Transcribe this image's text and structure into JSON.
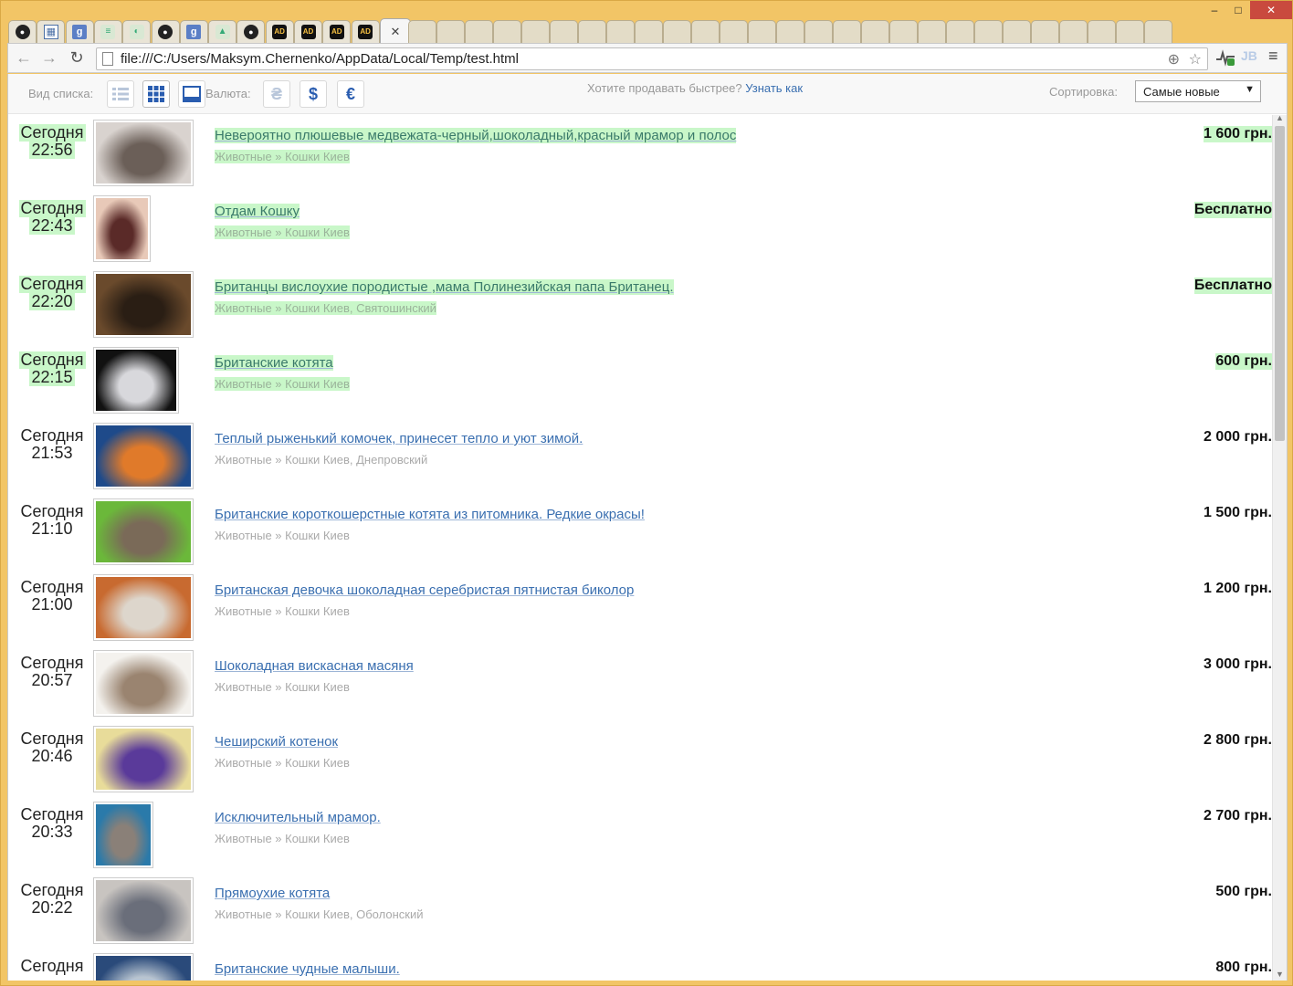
{
  "browser": {
    "url": "file:///C:/Users/Maksym.Chernenko/AppData/Local/Temp/test.html",
    "tabs": [
      {
        "icon": "github-icon"
      },
      {
        "icon": "grid-icon"
      },
      {
        "icon": "google-icon"
      },
      {
        "icon": "doc-icon"
      },
      {
        "icon": "code-icon"
      },
      {
        "icon": "github-icon"
      },
      {
        "icon": "google-icon"
      },
      {
        "icon": "ghost-icon"
      },
      {
        "icon": "github-icon"
      },
      {
        "icon": "ad-icon"
      },
      {
        "icon": "ad-icon"
      },
      {
        "icon": "ad-icon"
      },
      {
        "icon": "ad-icon"
      }
    ],
    "active_tab_close": "✕",
    "ad_label": "AD",
    "win_buttons": {
      "minimize": "–",
      "maximize": "□",
      "close": "✕"
    }
  },
  "filters": {
    "view_label": "Вид списка:",
    "currency_label": "Валюта:",
    "currency_uah": "₴",
    "currency_usd": "$",
    "currency_eur": "€",
    "promo_text": "Хотите продавать быстрее?",
    "promo_link": "Узнать как",
    "sort_label": "Сортировка:",
    "sort_value": "Самые новые"
  },
  "listings": [
    {
      "day": "Сегодня",
      "time": "22:56",
      "title": "Невероятно плюшевые медвежата-черный,шоколадный,красный мрамор и полос",
      "category": "Животные » Кошки Киев",
      "price": "1 600 грн.",
      "highlight": true,
      "thumb_colors": [
        "#d9d3cf",
        "#6b5f58"
      ]
    },
    {
      "day": "Сегодня",
      "time": "22:43",
      "title": "Отдам Кошку",
      "category": "Животные » Кошки Киев",
      "price": "Бесплатно",
      "highlight": true,
      "thumb_colors": [
        "#e8c9b8",
        "#5a2a28"
      ]
    },
    {
      "day": "Сегодня",
      "time": "22:20",
      "title": "Британцы вислоухие породистые ,мама Полинезийская папа Британец.",
      "category": "Животные » Кошки Киев, Святошинский",
      "price": "Бесплатно",
      "highlight": true,
      "thumb_colors": [
        "#6a4a2c",
        "#2a1e14"
      ]
    },
    {
      "day": "Сегодня",
      "time": "22:15",
      "title": "Британские котята",
      "category": "Животные » Кошки Киев",
      "price": "600 грн.",
      "highlight": true,
      "thumb_colors": [
        "#111111",
        "#d8d8dc"
      ]
    },
    {
      "day": "Сегодня",
      "time": "21:53",
      "title": "Теплый рыженький комочек, принесет тепло и уют зимой.",
      "category": "Животные » Кошки Киев, Днепровский",
      "price": "2 000 грн.",
      "highlight": false,
      "thumb_colors": [
        "#1e4a8a",
        "#e07a2a"
      ]
    },
    {
      "day": "Сегодня",
      "time": "21:10",
      "title": "Британские короткошерстные котята из питомника. Редкие окрасы!",
      "category": "Животные » Кошки Киев",
      "price": "1 500 грн.",
      "highlight": false,
      "thumb_colors": [
        "#6bb83a",
        "#7a6a58"
      ]
    },
    {
      "day": "Сегодня",
      "time": "21:00",
      "title": "Британская девочка шоколадная серебристая пятнистая биколор",
      "category": "Животные » Кошки Киев",
      "price": "1 200 грн.",
      "highlight": false,
      "thumb_colors": [
        "#c86a30",
        "#ddd6cc"
      ]
    },
    {
      "day": "Сегодня",
      "time": "20:57",
      "title": "Шоколадная вискасная масяня",
      "category": "Животные » Кошки Киев",
      "price": "3 000 грн.",
      "highlight": false,
      "thumb_colors": [
        "#f4f2ee",
        "#9a8470"
      ]
    },
    {
      "day": "Сегодня",
      "time": "20:46",
      "title": "Чеширский котенок",
      "category": "Животные » Кошки Киев",
      "price": "2 800 грн.",
      "highlight": false,
      "thumb_colors": [
        "#e8dc9a",
        "#5a3a9a"
      ]
    },
    {
      "day": "Сегодня",
      "time": "20:33",
      "title": "Исключительный мрамор.",
      "category": "Животные » Кошки Киев",
      "price": "2 700 грн.",
      "highlight": false,
      "thumb_colors": [
        "#2a7aaa",
        "#8a8078"
      ]
    },
    {
      "day": "Сегодня",
      "time": "20:22",
      "title": "Прямоухие котята",
      "category": "Животные » Кошки Киев, Оболонский",
      "price": "500 грн.",
      "highlight": false,
      "thumb_colors": [
        "#c8c4c0",
        "#6a6e7a"
      ]
    },
    {
      "day": "Сегодня",
      "time": "",
      "title": "Британские чудные малыши.",
      "category": "",
      "price": "800 грн.",
      "highlight": false,
      "thumb_colors": [
        "#2a4a7a",
        "#b8c4d0"
      ]
    }
  ]
}
